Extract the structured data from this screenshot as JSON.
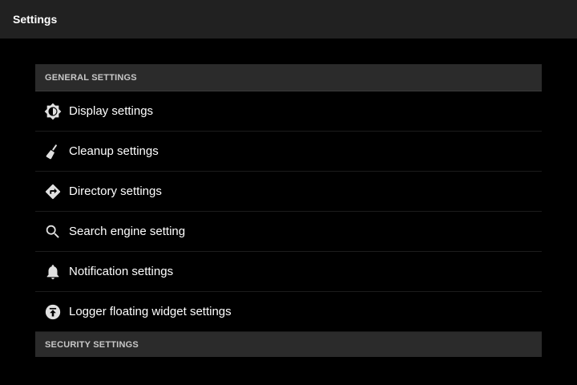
{
  "app_bar": {
    "title": "Settings"
  },
  "sections": {
    "general": {
      "header": "GENERAL SETTINGS",
      "items": [
        {
          "label": "Display settings",
          "icon": "brightness-icon"
        },
        {
          "label": "Cleanup settings",
          "icon": "broom-icon"
        },
        {
          "label": "Directory settings",
          "icon": "directions-icon"
        },
        {
          "label": "Search engine setting",
          "icon": "search-icon"
        },
        {
          "label": "Notification settings",
          "icon": "bell-icon"
        },
        {
          "label": "Logger floating widget settings",
          "icon": "upload-circle-icon"
        }
      ]
    },
    "security": {
      "header": "SECURITY SETTINGS"
    }
  },
  "colors": {
    "background": "#000000",
    "app_bar": "#212121",
    "section_header": "#2b2b2b",
    "text": "#ffffff",
    "header_text": "#c8c8c8",
    "icon": "#e0e0e0"
  }
}
